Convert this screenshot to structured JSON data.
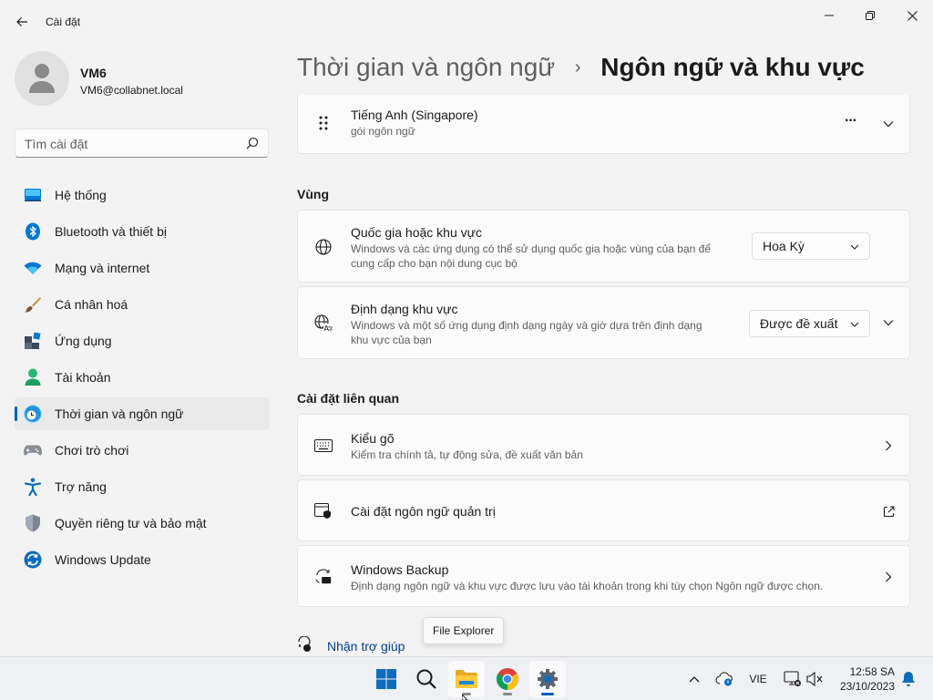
{
  "window": {
    "title": "Cài đặt"
  },
  "profile": {
    "name": "VM6",
    "email": "VM6@collabnet.local"
  },
  "search": {
    "placeholder": "Tìm cài đặt"
  },
  "sidebar": {
    "items": [
      {
        "label": "Hệ thống",
        "icon": "system-icon"
      },
      {
        "label": "Bluetooth và thiết bị",
        "icon": "bluetooth-icon"
      },
      {
        "label": "Mạng và internet",
        "icon": "wifi-icon"
      },
      {
        "label": "Cá nhân hoá",
        "icon": "brush-icon"
      },
      {
        "label": "Ứng dụng",
        "icon": "apps-icon"
      },
      {
        "label": "Tài khoản",
        "icon": "account-icon"
      },
      {
        "label": "Thời gian và ngôn ngữ",
        "icon": "time-language-icon",
        "active": true
      },
      {
        "label": "Chơi trò chơi",
        "icon": "gaming-icon"
      },
      {
        "label": "Trợ năng",
        "icon": "accessibility-icon"
      },
      {
        "label": "Quyền riêng tư và bảo mật",
        "icon": "shield-icon"
      },
      {
        "label": "Windows Update",
        "icon": "update-icon"
      }
    ]
  },
  "breadcrumb": {
    "parent": "Thời gian và ngôn ngữ",
    "separator": "›",
    "current": "Ngôn ngữ và khu vực"
  },
  "language_card": {
    "title": "Tiếng Anh (Singapore)",
    "subtitle": "gói ngôn ngữ",
    "more": "···"
  },
  "region_section": {
    "title": "Vùng",
    "country": {
      "title": "Quốc gia hoặc khu vực",
      "desc_line1": "Windows và các ứng dụng có thể sử dụng quốc gia hoặc vùng của bạn để",
      "desc_line2": "cung cấp cho bạn nội dung cục bộ",
      "value": "Hoa Kỳ"
    },
    "format": {
      "title": "Định dạng khu vực",
      "desc_line1": "Windows và một số ứng dụng định dạng ngày và giờ dựa trên định dạng",
      "desc_line2": "khu vực của bạn",
      "value": "Được đề xuất"
    }
  },
  "related_section": {
    "title": "Cài đặt liên quan",
    "typing": {
      "title": "Kiểu gõ",
      "desc": "Kiểm tra chính tả, tự động sửa, đề xuất văn bản"
    },
    "admin": {
      "title": "Cài đặt ngôn ngữ quản trị"
    },
    "backup": {
      "title": "Windows Backup",
      "desc": "Định dạng ngôn ngữ và khu vực được lưu vào tài khoản trong khi tùy chọn Ngôn ngữ được chọn."
    }
  },
  "help": {
    "label": "Nhận trợ giúp"
  },
  "tooltip": {
    "text": "File Explorer"
  },
  "taskbar": {
    "language": "VIE",
    "time": "12:58 SA",
    "date": "23/10/2023"
  },
  "colors": {
    "accent": "#005fb8",
    "link": "#003e92",
    "background": "#f3f3f3",
    "card": "#fbfbfb"
  }
}
